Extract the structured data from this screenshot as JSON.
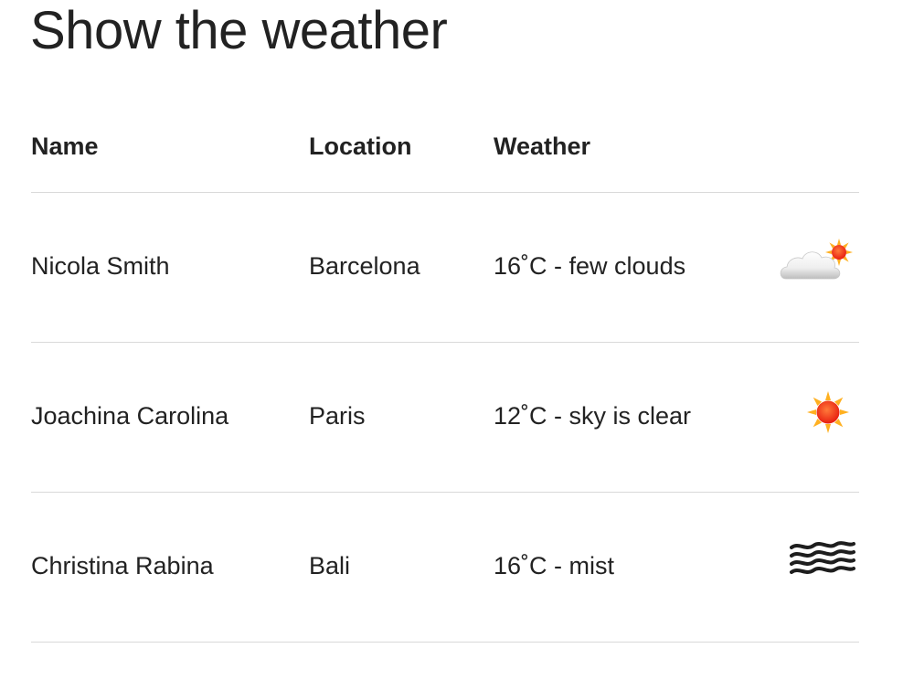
{
  "page": {
    "title": "Show the weather"
  },
  "table": {
    "headers": {
      "name": "Name",
      "location": "Location",
      "weather": "Weather"
    },
    "rows": [
      {
        "name": "Nicola Smith",
        "location": "Barcelona",
        "weather": "16˚C - few clouds",
        "icon": "few-clouds-icon"
      },
      {
        "name": "Joachina Carolina",
        "location": "Paris",
        "weather": "12˚C - sky is clear",
        "icon": "sun-icon"
      },
      {
        "name": "Christina Rabina",
        "location": "Bali",
        "weather": "16˚C - mist",
        "icon": "mist-icon"
      }
    ]
  },
  "colors": {
    "text": "#222222",
    "divider": "#d9d9d9",
    "sun": "#ff3b1f",
    "sun_rays": "#ffb020"
  }
}
